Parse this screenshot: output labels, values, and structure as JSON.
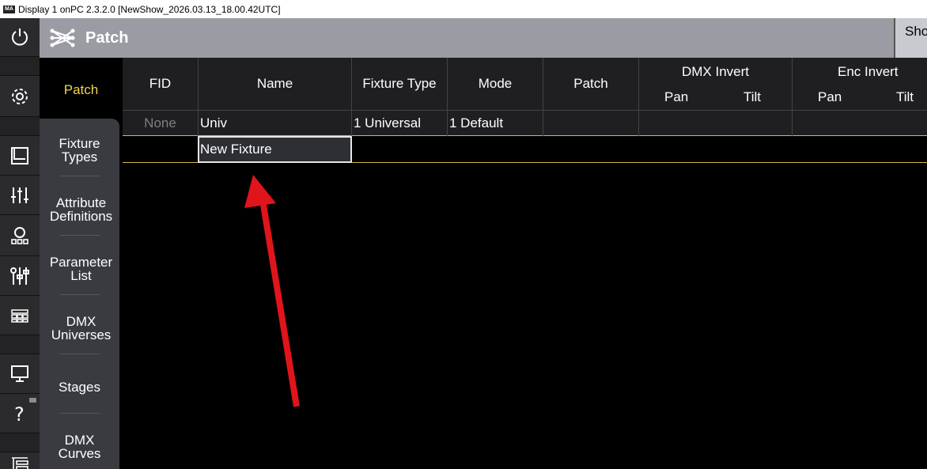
{
  "window": {
    "title": "Display 1 onPC 2.3.2.0 [NewShow_2026.03.13_18.00.42UTC]",
    "app_icon": "MA"
  },
  "header": {
    "title": "Patch",
    "shortcut_label": "Sho Pos"
  },
  "rail": {
    "icons": [
      "power-icon",
      "gear-icon",
      "book-icon",
      "faders-icon",
      "person-group-icon",
      "sliders-icon",
      "grid-icon",
      "monitor-icon",
      "help-icon",
      "tree-icon"
    ]
  },
  "subnav": {
    "items": [
      {
        "label": "Patch",
        "active": true
      },
      {
        "label": "Fixture Types"
      },
      {
        "label": "Attribute Definitions"
      },
      {
        "label": "Parameter List"
      },
      {
        "label": "DMX Universes"
      },
      {
        "label": "Stages"
      },
      {
        "label": "DMX Curves"
      }
    ]
  },
  "table": {
    "columns": {
      "fid": "FID",
      "name": "Name",
      "fixture_type": "Fixture Type",
      "mode": "Mode",
      "patch": "Patch",
      "dmx_invert": "DMX Invert",
      "enc_invert": "Enc Invert",
      "pan": "Pan",
      "tilt": "Tilt"
    },
    "rows": [
      {
        "fid": "None",
        "name": "Univ",
        "fixture_type": "1 Universal",
        "mode": "1 Default",
        "patch": ""
      }
    ],
    "new_row": {
      "name": "New Fixture"
    }
  },
  "colors": {
    "accent": "#f2d44a",
    "header_bg": "#9b9ca3",
    "row_border": "#d7b84b",
    "arrow": "#e0141b"
  }
}
